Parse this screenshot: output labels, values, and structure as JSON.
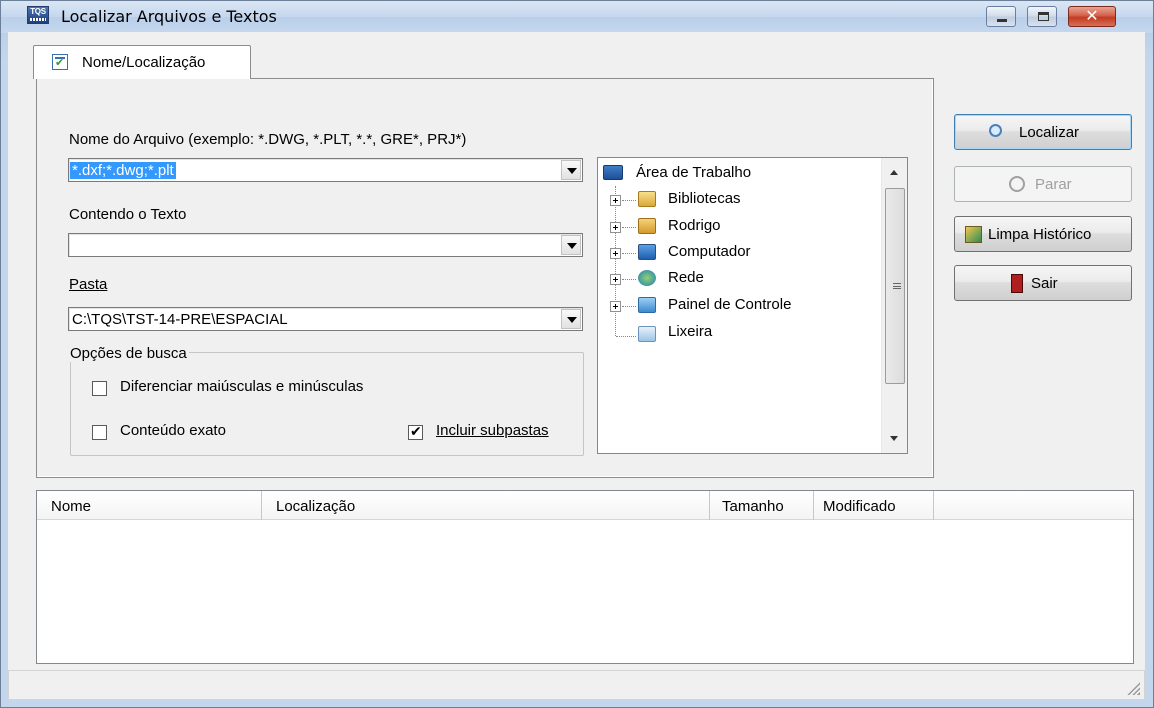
{
  "window": {
    "title": "Localizar Arquivos e Textos",
    "app_icon_text": "TQS"
  },
  "tab": {
    "label": "Nome/Localização"
  },
  "form": {
    "filename_label": "Nome do Arquivo (exemplo: *.DWG, *.PLT, *.*, GRE*, PRJ*)",
    "filename_value": "*.dxf;*.dwg;*.plt",
    "contains_label": "Contendo o Texto",
    "contains_value": "",
    "folder_label": "Pasta",
    "folder_value": "C:\\TQS\\TST-14-PRE\\ESPACIAL"
  },
  "options": {
    "title": "Opções de busca",
    "case_label": "Diferenciar maiúsculas e minúsculas",
    "case_checked": false,
    "exact_label": "Conteúdo exato",
    "exact_checked": false,
    "subfolders_label": "Incluir subpastas",
    "subfolders_checked": true
  },
  "tree": {
    "root": "Área de Trabalho",
    "items": [
      {
        "label": "Bibliotecas",
        "icon": "libraries-icon"
      },
      {
        "label": "Rodrigo",
        "icon": "user-folder-icon"
      },
      {
        "label": "Computador",
        "icon": "computer-icon"
      },
      {
        "label": "Rede",
        "icon": "network-icon"
      },
      {
        "label": "Painel de Controle",
        "icon": "control-panel-icon"
      },
      {
        "label": "Lixeira",
        "icon": "recycle-bin-icon"
      }
    ]
  },
  "buttons": {
    "search": "Localizar",
    "stop": "Parar",
    "clear_history": "Limpa Histórico",
    "exit": "Sair"
  },
  "results": {
    "columns": [
      "Nome",
      "Localização",
      "Tamanho",
      "Modificado"
    ],
    "rows": []
  },
  "colors": {
    "selection": "#3399ff",
    "title_gradient_top": "#dbe6f4",
    "close_button": "#c23b1f"
  }
}
